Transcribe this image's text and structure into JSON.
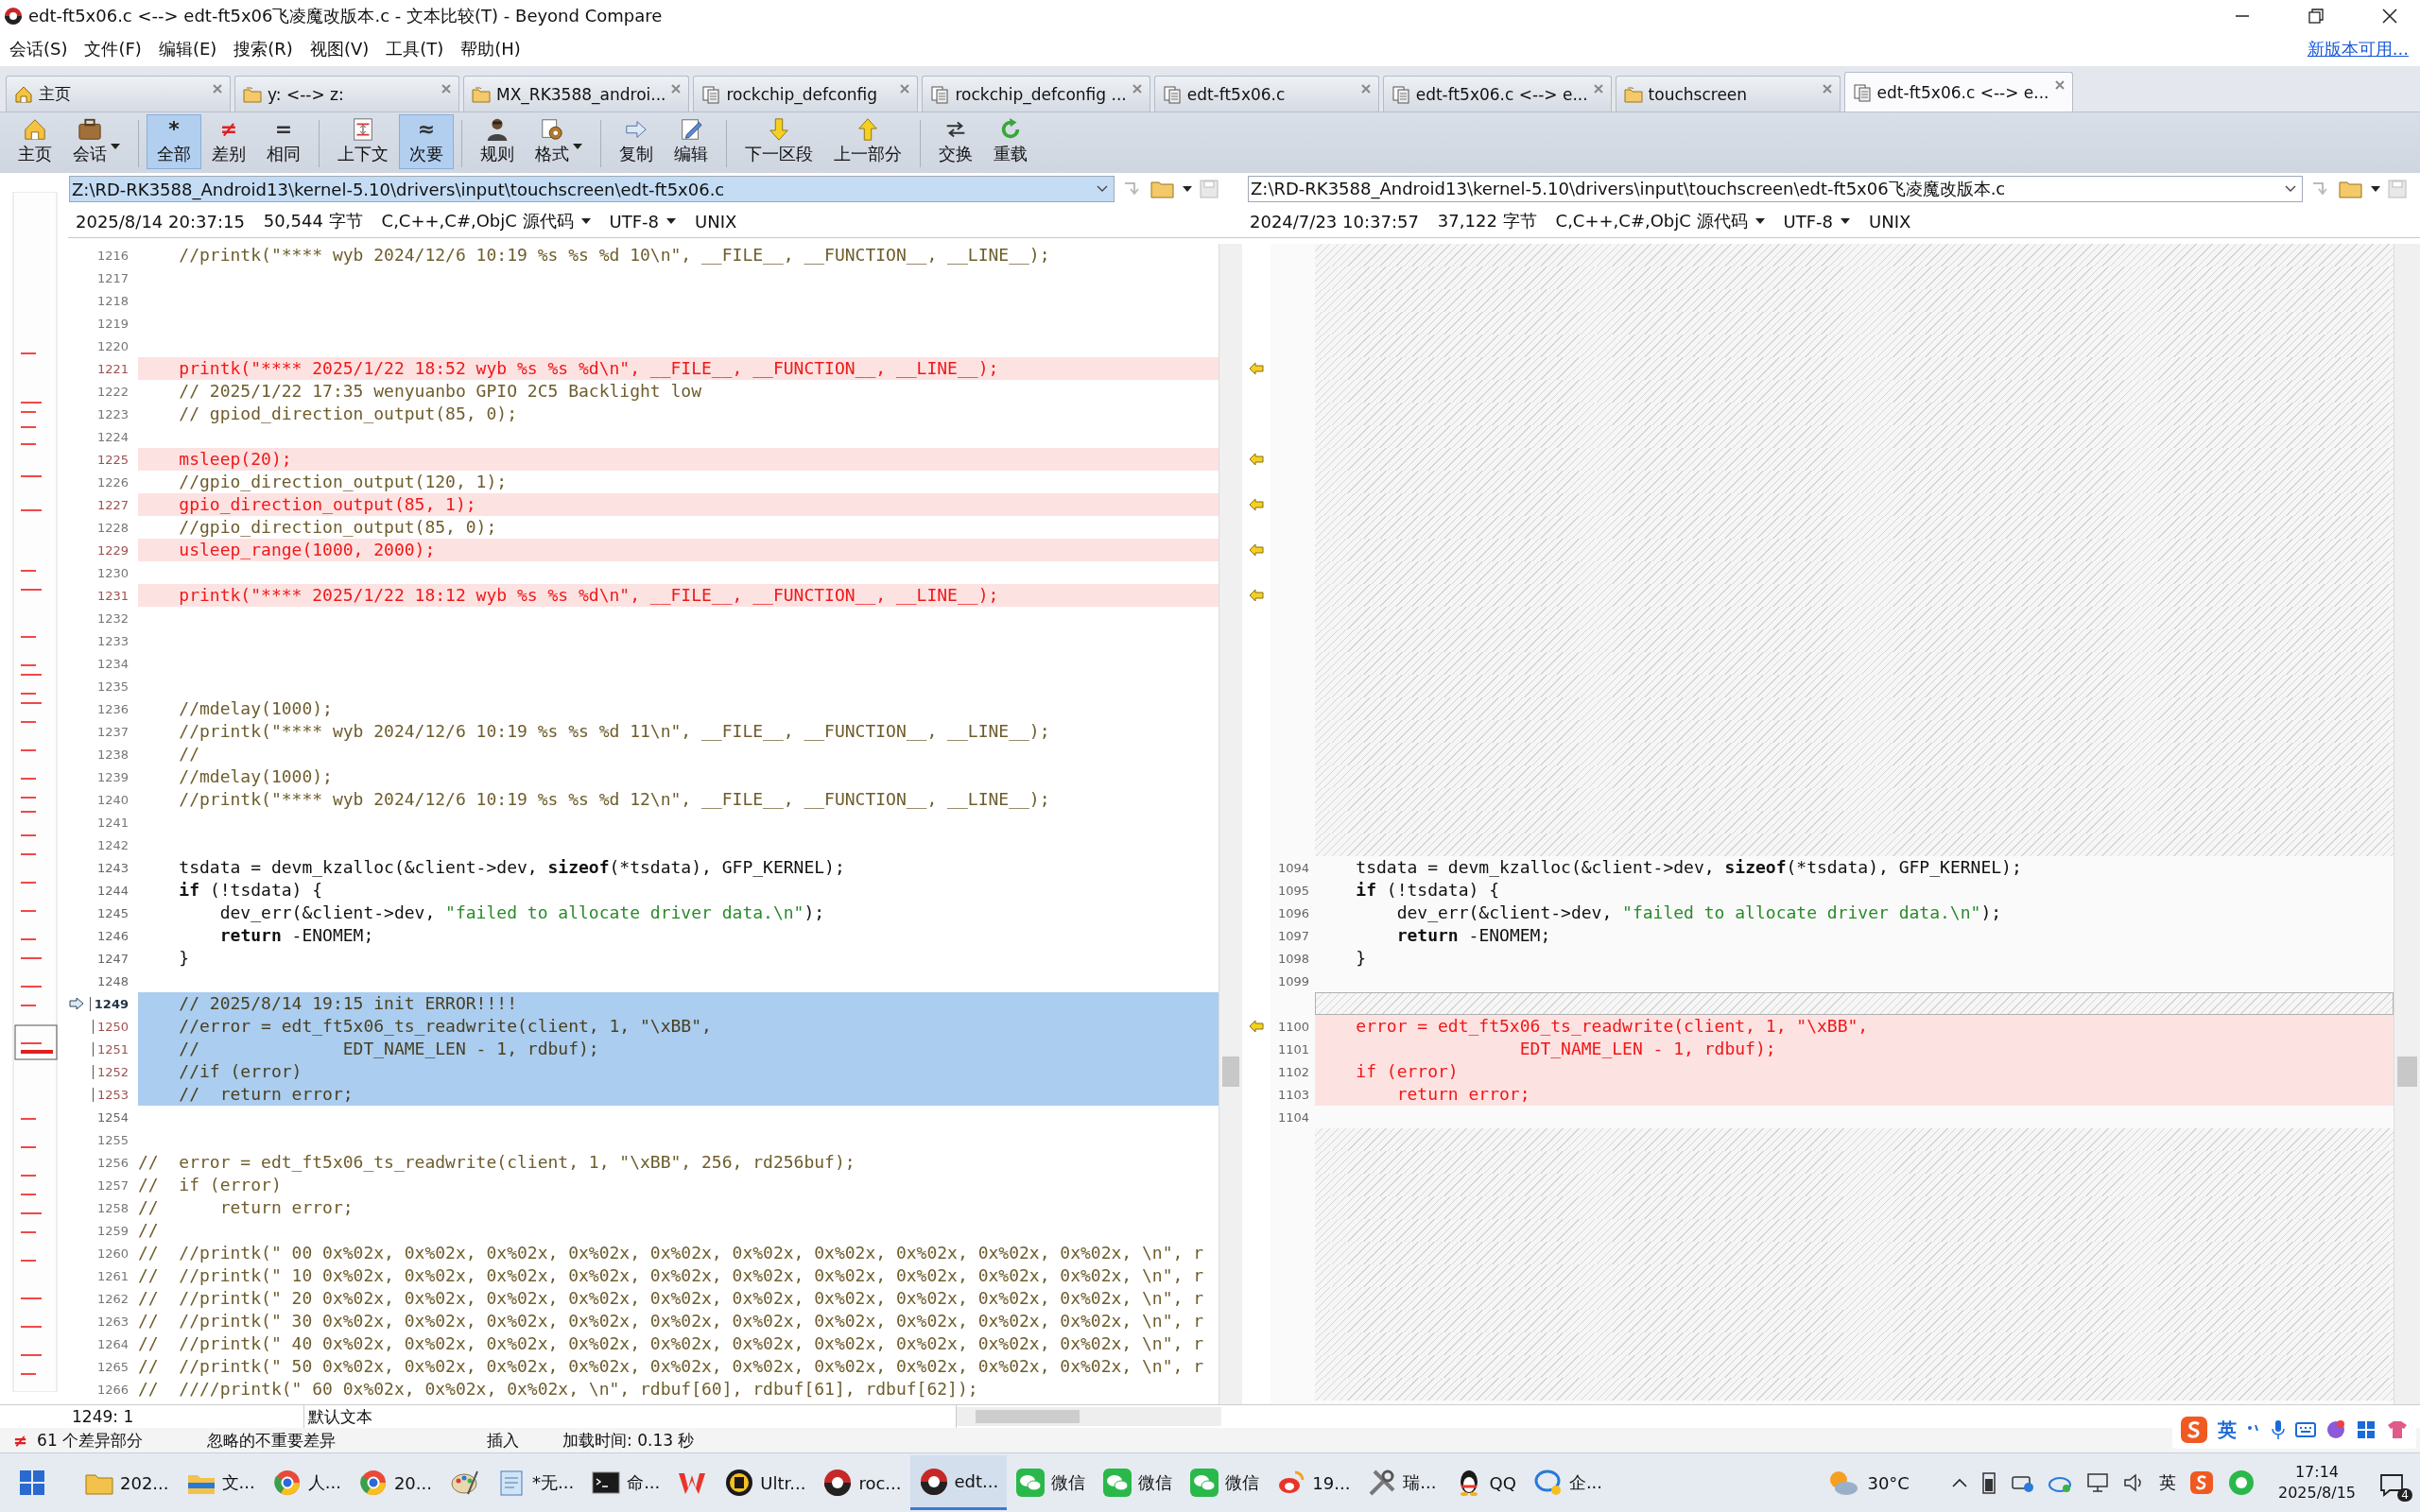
{
  "window": {
    "title": "edt-ft5x06.c <--> edt-ft5x06飞凌魔改版本.c - 文本比较(T) - Beyond Compare"
  },
  "menu": [
    "会话(S)",
    "文件(F)",
    "编辑(E)",
    "搜索(R)",
    "视图(V)",
    "工具(T)",
    "帮助(H)"
  ],
  "update_link": "新版本可用...",
  "tabs": [
    {
      "label": "主页",
      "kind": "home",
      "selected": false
    },
    {
      "label": "y: <--> z:",
      "kind": "folder",
      "selected": false
    },
    {
      "label": "MX_RK3588_androi...",
      "kind": "folder",
      "selected": false
    },
    {
      "label": "rockchip_defconfig",
      "kind": "file",
      "selected": false
    },
    {
      "label": "rockchip_defconfig ...",
      "kind": "file",
      "selected": false
    },
    {
      "label": "edt-ft5x06.c",
      "kind": "file",
      "selected": false
    },
    {
      "label": "edt-ft5x06.c <--> e...",
      "kind": "file",
      "selected": false
    },
    {
      "label": "touchscreen",
      "kind": "folder",
      "selected": false
    },
    {
      "label": "edt-ft5x06.c <--> e...",
      "kind": "file",
      "selected": true
    }
  ],
  "toolbar": [
    {
      "items": [
        {
          "label": "主页",
          "kind": "home",
          "pressed": false,
          "dropdown": false
        },
        {
          "label": "会话",
          "kind": "briefcase",
          "pressed": false,
          "dropdown": true
        }
      ]
    },
    {
      "items": [
        {
          "label": "全部",
          "kind": "asterisk",
          "glyph": "*",
          "pressed": true,
          "dropdown": false
        },
        {
          "label": "差别",
          "kind": "not-equal",
          "glyph": "≠",
          "pressed": false,
          "dropdown": false
        },
        {
          "label": "相同",
          "kind": "equals",
          "glyph": "=",
          "pressed": false,
          "dropdown": false
        }
      ]
    },
    {
      "items": [
        {
          "label": "上下文",
          "kind": "context",
          "pressed": false,
          "dropdown": false
        },
        {
          "label": "次要",
          "kind": "approx",
          "glyph": "≈",
          "pressed": true,
          "dropdown": false
        }
      ]
    },
    {
      "items": [
        {
          "label": "规则",
          "kind": "person",
          "pressed": false,
          "dropdown": false
        },
        {
          "label": "格式",
          "kind": "gear",
          "pressed": false,
          "dropdown": true
        }
      ]
    },
    {
      "items": [
        {
          "label": "复制",
          "kind": "copy",
          "pressed": false,
          "dropdown": false
        },
        {
          "label": "编辑",
          "kind": "edit",
          "pressed": false,
          "dropdown": false
        }
      ]
    },
    {
      "items": [
        {
          "label": "下一区段",
          "kind": "down",
          "pressed": false,
          "dropdown": false
        },
        {
          "label": "上一部分",
          "kind": "up",
          "pressed": false,
          "dropdown": false
        }
      ]
    },
    {
      "items": [
        {
          "label": "交换",
          "kind": "swap",
          "pressed": false,
          "dropdown": false
        },
        {
          "label": "重载",
          "kind": "reload",
          "pressed": false,
          "dropdown": false
        }
      ]
    }
  ],
  "left_pane": {
    "path": "Z:\\RD-RK3588_Android13\\kernel-5.10\\drivers\\input\\touchscreen\\edt-ft5x06.c",
    "info": {
      "timestamp": "2025/8/14 20:37:15",
      "size": "50,544 字节",
      "format": "C,C++,C#,ObjC 源代码",
      "encoding": "UTF-8",
      "line_endings": "UNIX"
    }
  },
  "right_pane": {
    "path": "Z:\\RD-RK3588_Android13\\kernel-5.10\\drivers\\input\\touchscreen\\edt-ft5x06飞凌魔改版本.c",
    "info": {
      "timestamp": "2024/7/23 10:37:57",
      "size": "37,122 字节",
      "format": "C,C++,C#,ObjC 源代码",
      "encoding": "UTF-8",
      "line_endings": "UNIX"
    }
  },
  "rows": [
    {
      "kind": "minor",
      "selected": false,
      "current": false,
      "left": {
        "num": "1216",
        "text": "    //printk(\"**** wyb 2024/12/6 10:19 %s %s %d 10\\n\", __FILE__, __FUNCTION__, __LINE__);"
      }
    },
    {
      "kind": "minor",
      "selected": false,
      "current": false,
      "left": {
        "num": "1217"
      }
    },
    {
      "kind": "minor",
      "selected": false,
      "current": false,
      "left": {
        "num": "1218"
      }
    },
    {
      "kind": "minor",
      "selected": false,
      "current": false,
      "left": {
        "num": "1219"
      }
    },
    {
      "kind": "minor",
      "selected": false,
      "current": false,
      "left": {
        "num": "1220"
      }
    },
    {
      "kind": "diff",
      "selected": false,
      "current": false,
      "left": {
        "num": "1221",
        "text": "    printk(\"**** 2025/1/22 18:52 wyb %s %s %d\\n\", __FILE__, __FUNCTION__, __LINE__);"
      }
    },
    {
      "kind": "minor",
      "selected": false,
      "current": false,
      "left": {
        "num": "1222",
        "text": "    // 2025/1/22 17:35 wenyuanbo GPIO 2C5 Backlight low"
      }
    },
    {
      "kind": "minor",
      "selected": false,
      "current": false,
      "left": {
        "num": "1223",
        "text": "    // gpiod_direction_output(85, 0);"
      }
    },
    {
      "kind": "minor",
      "selected": false,
      "current": false,
      "left": {
        "num": "1224"
      }
    },
    {
      "kind": "diff",
      "selected": false,
      "current": false,
      "left": {
        "num": "1225",
        "text": "    msleep(20);"
      }
    },
    {
      "kind": "minor",
      "selected": false,
      "current": false,
      "left": {
        "num": "1226",
        "text": "    //gpio_direction_output(120, 1);"
      }
    },
    {
      "kind": "diff",
      "selected": false,
      "current": false,
      "left": {
        "num": "1227",
        "text": "    gpio_direction_output(85, 1);"
      }
    },
    {
      "kind": "minor",
      "selected": false,
      "current": false,
      "left": {
        "num": "1228",
        "text": "    //gpio_direction_output(85, 0);"
      }
    },
    {
      "kind": "diff",
      "selected": false,
      "current": false,
      "left": {
        "num": "1229",
        "text": "    usleep_range(1000, 2000);"
      }
    },
    {
      "kind": "minor",
      "selected": false,
      "current": false,
      "left": {
        "num": "1230"
      }
    },
    {
      "kind": "diff",
      "selected": false,
      "current": false,
      "left": {
        "num": "1231",
        "text": "    printk(\"**** 2025/1/22 18:12 wyb %s %s %d\\n\", __FILE__, __FUNCTION__, __LINE__);"
      }
    },
    {
      "kind": "minor",
      "selected": false,
      "current": false,
      "left": {
        "num": "1232"
      }
    },
    {
      "kind": "minor",
      "selected": false,
      "current": false,
      "left": {
        "num": "1233"
      }
    },
    {
      "kind": "minor",
      "selected": false,
      "current": false,
      "left": {
        "num": "1234"
      }
    },
    {
      "kind": "minor",
      "selected": false,
      "current": false,
      "left": {
        "num": "1235"
      }
    },
    {
      "kind": "minor",
      "selected": false,
      "current": false,
      "left": {
        "num": "1236",
        "text": "    //mdelay(1000);"
      }
    },
    {
      "kind": "minor",
      "selected": false,
      "current": false,
      "left": {
        "num": "1237",
        "text": "    //printk(\"**** wyb 2024/12/6 10:19 %s %s %d 11\\n\", __FILE__, __FUNCTION__, __LINE__);"
      }
    },
    {
      "kind": "minor",
      "selected": false,
      "current": false,
      "left": {
        "num": "1238",
        "text": "    //"
      }
    },
    {
      "kind": "minor",
      "selected": false,
      "current": false,
      "left": {
        "num": "1239",
        "text": "    //mdelay(1000);"
      }
    },
    {
      "kind": "minor",
      "selected": false,
      "current": false,
      "left": {
        "num": "1240",
        "text": "    //printk(\"**** wyb 2024/12/6 10:19 %s %s %d 12\\n\", __FILE__, __FUNCTION__, __LINE__);"
      }
    },
    {
      "kind": "minor",
      "selected": false,
      "current": false,
      "left": {
        "num": "1241"
      }
    },
    {
      "kind": "minor",
      "selected": false,
      "current": false,
      "left": {
        "num": "1242"
      }
    },
    {
      "kind": "same",
      "selected": false,
      "current": false,
      "left": {
        "num": "1243",
        "text": "    tsdata = devm_kzalloc(&client->dev, **sizeof**(*tsdata), GFP_KERNEL);"
      },
      "right": {
        "num": "1094",
        "text": "    tsdata = devm_kzalloc(&client->dev, **sizeof**(*tsdata), GFP_KERNEL);"
      }
    },
    {
      "kind": "same",
      "selected": false,
      "current": false,
      "left": {
        "num": "1244",
        "text": "    **if** (!tsdata) {"
      },
      "right": {
        "num": "1095",
        "text": "    **if** (!tsdata) {"
      }
    },
    {
      "kind": "same",
      "selected": false,
      "current": false,
      "left": {
        "num": "1245",
        "text": "        dev_err(&client->dev, \"failed to allocate driver data.\\n\");"
      },
      "right": {
        "num": "1096",
        "text": "        dev_err(&client->dev, \"failed to allocate driver data.\\n\");"
      }
    },
    {
      "kind": "same",
      "selected": false,
      "current": false,
      "left": {
        "num": "1246",
        "text": "        **return** -ENOMEM;"
      },
      "right": {
        "num": "1097",
        "text": "        **return** -ENOMEM;"
      }
    },
    {
      "kind": "same",
      "selected": false,
      "current": false,
      "left": {
        "num": "1247",
        "text": "    }"
      },
      "right": {
        "num": "1098",
        "text": "    }"
      }
    },
    {
      "kind": "same",
      "selected": false,
      "current": false,
      "left": {
        "num": "1248"
      },
      "right": {
        "num": "1099"
      }
    },
    {
      "kind": "minor",
      "selected": true,
      "current": true,
      "left": {
        "num": "1249",
        "text": "    // 2025/8/14 19:15 init ERROR!!!!"
      }
    },
    {
      "kind": "diff",
      "selected": true,
      "current": false,
      "left": {
        "num": "1250",
        "text": "    //error = edt_ft5x06_ts_readwrite(client, 1, \"\\xBB\","
      },
      "right": {
        "num": "1100",
        "text": "    error = edt_ft5x06_ts_readwrite(client, 1, \"\\xBB\","
      }
    },
    {
      "kind": "diff",
      "selected": true,
      "current": false,
      "left": {
        "num": "1251",
        "text": "    //              EDT_NAME_LEN - 1, rdbuf);"
      },
      "right": {
        "num": "1101",
        "text": "                    EDT_NAME_LEN - 1, rdbuf);"
      }
    },
    {
      "kind": "diff",
      "selected": true,
      "current": false,
      "left": {
        "num": "1252",
        "text": "    //if (error)"
      },
      "right": {
        "num": "1102",
        "text": "    if (error)"
      }
    },
    {
      "kind": "diff",
      "selected": true,
      "current": false,
      "left": {
        "num": "1253",
        "text": "    //  return error;"
      },
      "right": {
        "num": "1103",
        "text": "        return error;"
      }
    },
    {
      "kind": "same",
      "selected": false,
      "current": false,
      "left": {
        "num": "1254"
      },
      "right": {
        "num": "1104"
      }
    },
    {
      "kind": "minor",
      "selected": false,
      "current": false,
      "left": {
        "num": "1255"
      }
    },
    {
      "kind": "minor",
      "selected": false,
      "current": false,
      "left": {
        "num": "1256",
        "text": "//  error = edt_ft5x06_ts_readwrite(client, 1, \"\\xBB\", 256, rd256buf);"
      }
    },
    {
      "kind": "minor",
      "selected": false,
      "current": false,
      "left": {
        "num": "1257",
        "text": "//  if (error)"
      }
    },
    {
      "kind": "minor",
      "selected": false,
      "current": false,
      "left": {
        "num": "1258",
        "text": "//      return error;"
      }
    },
    {
      "kind": "minor",
      "selected": false,
      "current": false,
      "left": {
        "num": "1259",
        "text": "//"
      }
    },
    {
      "kind": "minor",
      "selected": false,
      "current": false,
      "left": {
        "num": "1260",
        "text": "//  //printk(\" 00 0x%02x, 0x%02x, 0x%02x, 0x%02x, 0x%02x, 0x%02x, 0x%02x, 0x%02x, 0x%02x, 0x%02x, \\n\", r"
      }
    },
    {
      "kind": "minor",
      "selected": false,
      "current": false,
      "left": {
        "num": "1261",
        "text": "//  //printk(\" 10 0x%02x, 0x%02x, 0x%02x, 0x%02x, 0x%02x, 0x%02x, 0x%02x, 0x%02x, 0x%02x, 0x%02x, \\n\", r"
      }
    },
    {
      "kind": "minor",
      "selected": false,
      "current": false,
      "left": {
        "num": "1262",
        "text": "//  //printk(\" 20 0x%02x, 0x%02x, 0x%02x, 0x%02x, 0x%02x, 0x%02x, 0x%02x, 0x%02x, 0x%02x, 0x%02x, \\n\", r"
      }
    },
    {
      "kind": "minor",
      "selected": false,
      "current": false,
      "left": {
        "num": "1263",
        "text": "//  //printk(\" 30 0x%02x, 0x%02x, 0x%02x, 0x%02x, 0x%02x, 0x%02x, 0x%02x, 0x%02x, 0x%02x, 0x%02x, \\n\", r"
      }
    },
    {
      "kind": "minor",
      "selected": false,
      "current": false,
      "left": {
        "num": "1264",
        "text": "//  //printk(\" 40 0x%02x, 0x%02x, 0x%02x, 0x%02x, 0x%02x, 0x%02x, 0x%02x, 0x%02x, 0x%02x, 0x%02x, \\n\", r"
      }
    },
    {
      "kind": "minor",
      "selected": false,
      "current": false,
      "left": {
        "num": "1265",
        "text": "//  //printk(\" 50 0x%02x, 0x%02x, 0x%02x, 0x%02x, 0x%02x, 0x%02x, 0x%02x, 0x%02x, 0x%02x, 0x%02x, \\n\", r"
      }
    },
    {
      "kind": "minor",
      "selected": false,
      "current": false,
      "left": {
        "num": "1266",
        "text": "//  ////printk(\" 60 0x%02x, 0x%02x, 0x%02x, \\n\", rdbuf[60], rdbuf[61], rdbuf[62]);"
      }
    }
  ],
  "status": {
    "cursor": "1249: 1",
    "text_type": "默认文本",
    "diff_count": "61 个差异部分",
    "ignored": "忽略的不重要差异",
    "mode": "插入",
    "load_time": "加载时间: 0.13 秒"
  },
  "ime_bar": {
    "label": "英"
  },
  "taskbar": {
    "items": [
      {
        "kind": "folder",
        "label": "202...",
        "selected": false
      },
      {
        "kind": "explorer",
        "label": "文...",
        "selected": false
      },
      {
        "kind": "browser",
        "label": "人...",
        "selected": false
      },
      {
        "kind": "browser",
        "label": "20...",
        "selected": false
      },
      {
        "kind": "paint",
        "selected": false
      },
      {
        "kind": "notepad",
        "label": "*无...",
        "selected": false
      },
      {
        "kind": "terminal",
        "label": "命...",
        "selected": false
      },
      {
        "kind": "wps",
        "selected": false
      },
      {
        "kind": "ue",
        "label": "Ultr...",
        "selected": false
      },
      {
        "kind": "bc",
        "label": "roc...",
        "selected": false
      },
      {
        "kind": "bc",
        "label": "edt...",
        "selected": true
      },
      {
        "kind": "wechat",
        "label": "微信",
        "selected": false
      },
      {
        "kind": "wechat",
        "label": "微信",
        "selected": false
      },
      {
        "kind": "wechat",
        "label": "微信",
        "selected": false
      },
      {
        "kind": "weibo",
        "label": "19...",
        "selected": false
      },
      {
        "kind": "tools",
        "label": "瑞...",
        "selected": false
      },
      {
        "kind": "qq",
        "label": "QQ",
        "selected": false
      },
      {
        "kind": "chat",
        "label": "企...",
        "selected": false
      }
    ],
    "weather": "30°C",
    "tray_ime": "英",
    "time": "17:14",
    "date": "2025/8/15",
    "notifications": "4"
  }
}
